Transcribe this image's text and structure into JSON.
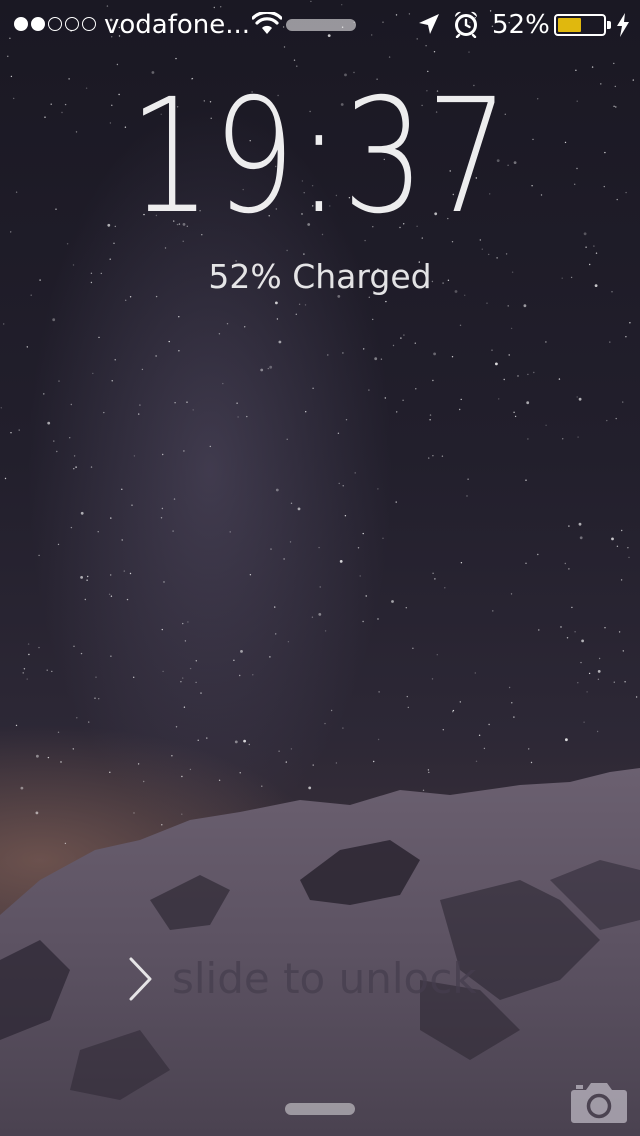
{
  "status_bar": {
    "signal_bars_filled": 2,
    "signal_bars_total": 5,
    "carrier": "vodafone...",
    "battery_percent_label": "52%",
    "battery_level": 0.52,
    "battery_color": "#e0b80e",
    "icons": [
      "wifi-icon",
      "location-arrow-icon",
      "alarm-clock-icon",
      "battery-icon",
      "charging-bolt-icon"
    ]
  },
  "lock_screen": {
    "time": "19:37",
    "charge_status": "52% Charged",
    "unlock_label": "slide to unlock"
  },
  "bottom": {
    "icons": [
      "camera-icon"
    ]
  }
}
